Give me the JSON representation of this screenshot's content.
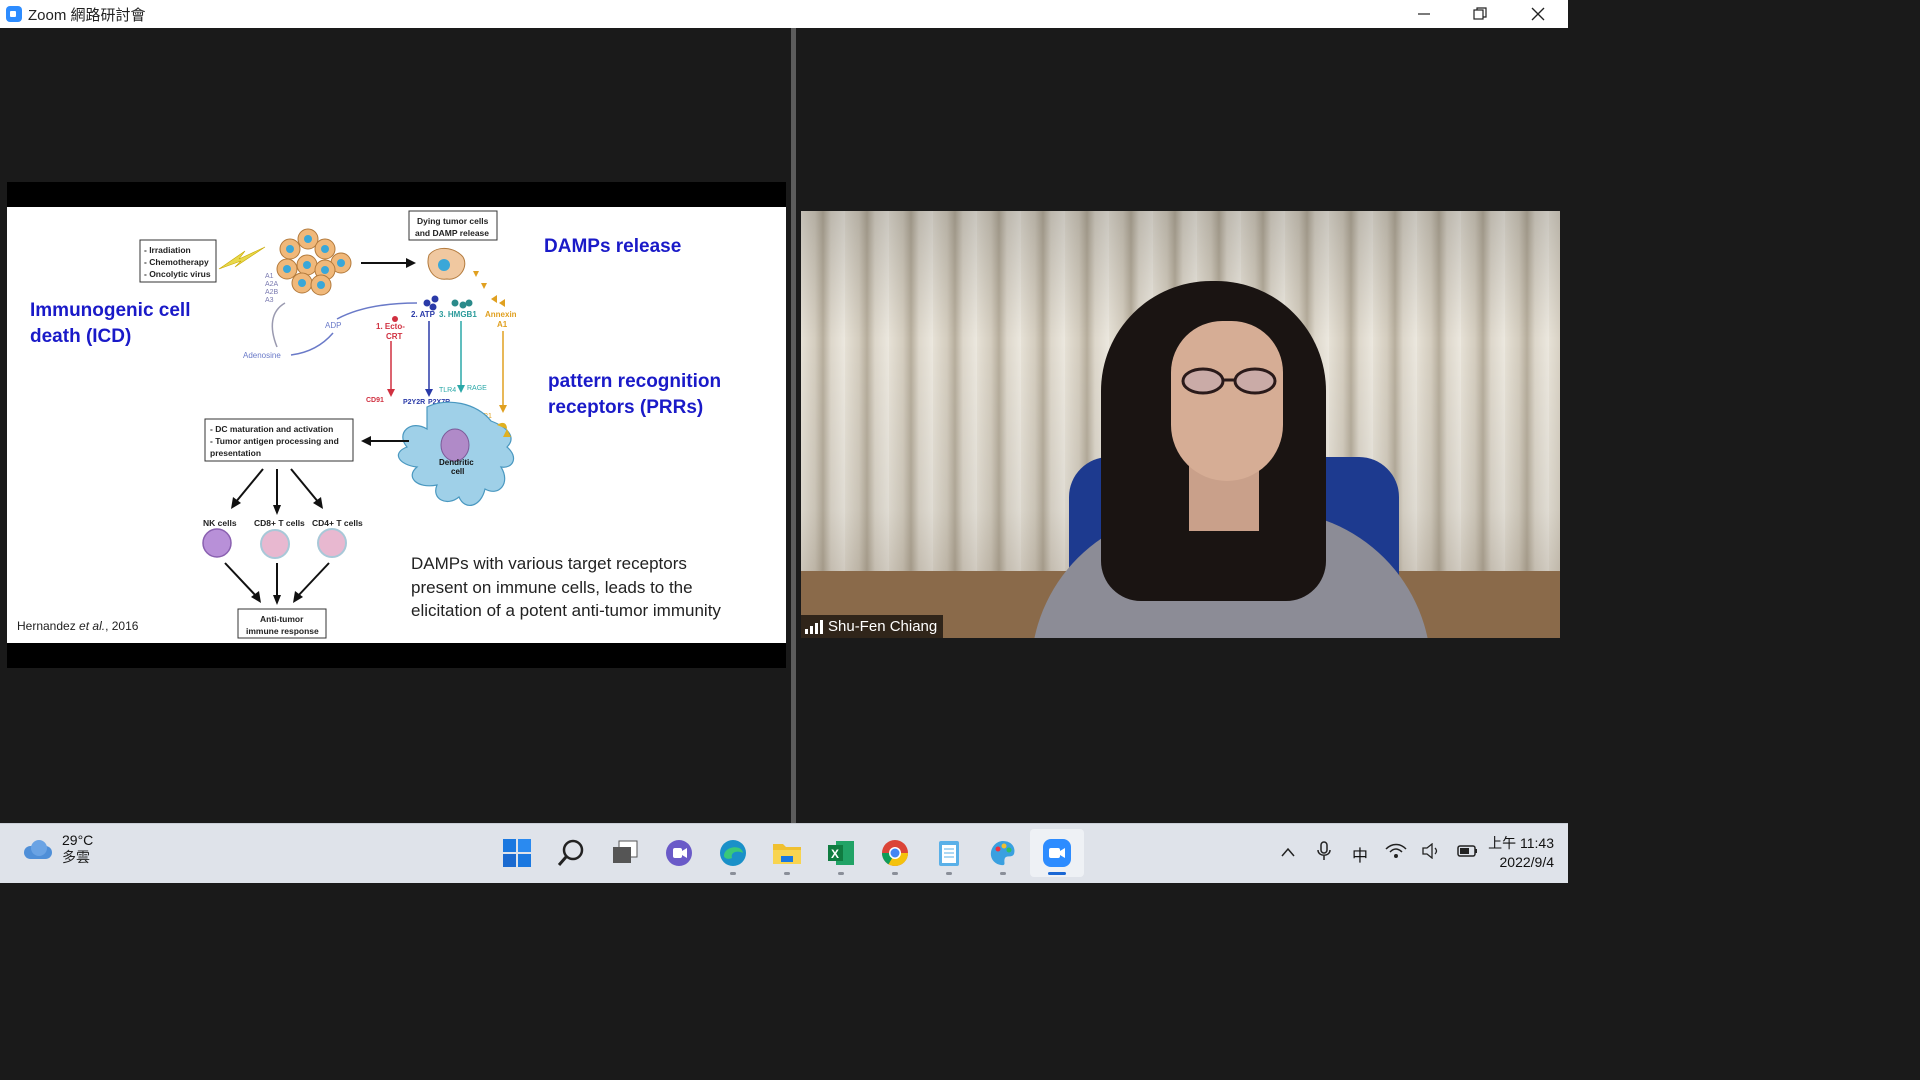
{
  "window": {
    "title": "Zoom 網路研討會"
  },
  "slide": {
    "icd_heading_line1": "Immunogenic cell",
    "icd_heading_line2": "death (ICD)",
    "damps_heading": "DAMPs  release",
    "prr_heading_line1": "pattern recognition",
    "prr_heading_line2": "receptors (PRRs)",
    "description_line1": "DAMPs  with various target receptors",
    "description_line2": "present on immune cells, leads to the",
    "description_line3": "elicitation of a potent anti-tumor immunity",
    "reference_author": "Hernandez ",
    "reference_etal": "et al.",
    "reference_year": ", 2016",
    "diagram": {
      "treatment_1": "- Irradiation",
      "treatment_2": "- Chemotherapy",
      "treatment_3": "- Oncolytic virus",
      "dying_1": "Dying tumor cells",
      "dying_2": "and DAMP release",
      "receptor_a1": "A1",
      "receptor_a2a": "A2A",
      "receptor_a2b": "A2B",
      "receptor_a3": "A3",
      "adp": "ADP",
      "adenosine": "Adenosine",
      "ecto_crt_1": "1. Ecto-",
      "ecto_crt_2": "CRT",
      "atp": "2. ATP",
      "hmgb1": "3. HMGB1",
      "annexin_1": "Annexin",
      "annexin_2": "A1",
      "cd91": "CD91",
      "p2y2r": "P2Y2R",
      "p2x7r": "P2X7R",
      "tlr4": "TLR4",
      "rage": "RAGE",
      "fpr1": "FPR1",
      "dc_1": "Dendritic",
      "dc_2": "cell",
      "dc_box_1": "- DC maturation and activation",
      "dc_box_2": "- Tumor antigen processing and",
      "dc_box_3": "presentation",
      "nk": "NK cells",
      "cd8": "CD8+ T cells",
      "cd4": "CD4+ T cells",
      "anti_1": "Anti-tumor",
      "anti_2": "immune response"
    }
  },
  "video": {
    "participant_name": "Shu-Fen Chiang"
  },
  "taskbar": {
    "weather_temp": "29°C",
    "weather_desc": "多雲",
    "ime": "中",
    "time": "上午 11:43",
    "date": "2022/9/4",
    "apps": [
      "start-icon",
      "search-icon",
      "task-view-icon",
      "teams-chat-icon",
      "edge-icon",
      "file-explorer-icon",
      "excel-icon",
      "chrome-icon",
      "notepad-icon",
      "paint-icon",
      "zoom-icon"
    ]
  },
  "colors": {
    "heading_blue": "#1a1ac8",
    "zoom_blue": "#2d8cff",
    "slide_background": "#ffffff",
    "app_background": "#1a1a1a"
  }
}
